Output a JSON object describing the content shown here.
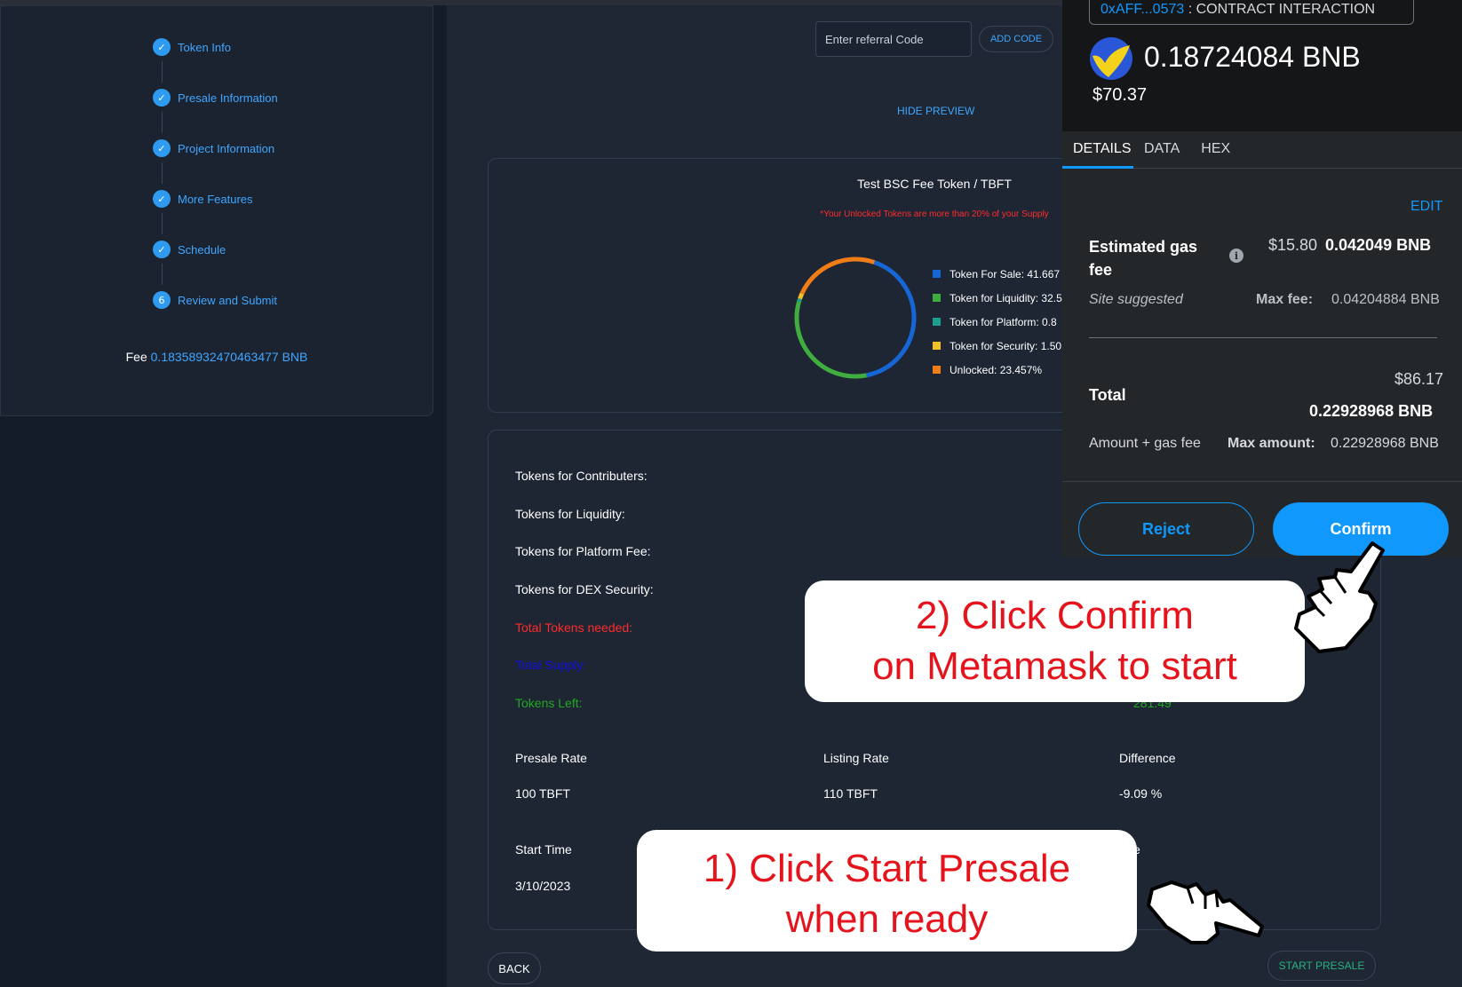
{
  "stepper": {
    "steps": [
      {
        "label": "Token Info",
        "marker": "✓"
      },
      {
        "label": "Presale Information",
        "marker": "✓"
      },
      {
        "label": "Project Information",
        "marker": "✓"
      },
      {
        "label": "More Features",
        "marker": "✓"
      },
      {
        "label": "Schedule",
        "marker": "✓"
      },
      {
        "label": "Review and Submit",
        "marker": "6"
      }
    ],
    "fee_label": "Fee",
    "fee_value": "0.18358932470463477 BNB"
  },
  "referral": {
    "placeholder": "Enter referral Code",
    "add_code_label": "ADD CODE"
  },
  "hide_preview_label": "HIDE PREVIEW",
  "token_chart": {
    "title": "Test BSC Fee Token / TBFT",
    "warning": "*Your Unlocked Tokens are more than 20% of your Supply",
    "legend": [
      {
        "label": "Token For Sale: 41.667",
        "color": "#1766d6"
      },
      {
        "label": "Token for Liquidity: 32.5",
        "color": "#3fae3f"
      },
      {
        "label": "Token for Platform: 0.8",
        "color": "#1d9e8f"
      },
      {
        "label": "Token for Security: 1.50",
        "color": "#f2c028"
      },
      {
        "label": "Unlocked: 23.457%",
        "color": "#f07d16"
      }
    ]
  },
  "chart_data": {
    "type": "pie",
    "donut": true,
    "categories": [
      "Token For Sale",
      "Token for Liquidity",
      "Token for Platform",
      "Token for Security",
      "Unlocked"
    ],
    "values": [
      41.667,
      32.5,
      0.8,
      1.5,
      23.457
    ],
    "colors": [
      "#1766d6",
      "#3fae3f",
      "#1d9e8f",
      "#f2c028",
      "#f07d16"
    ]
  },
  "summary": {
    "rows": [
      {
        "label": "Tokens for Contributers:",
        "color": "#ffffff"
      },
      {
        "label": "Tokens for Liquidity:",
        "color": "#ffffff"
      },
      {
        "label": "Tokens for Platform Fee:",
        "color": "#ffffff"
      },
      {
        "label": "Tokens for DEX Security:",
        "color": "#ffffff"
      },
      {
        "label": "Total Tokens needed:",
        "color": "#ff2b2b"
      },
      {
        "label": "Total Supply:",
        "color": "#1010e0"
      },
      {
        "label": "Tokens Left:",
        "color": "#22a822"
      }
    ],
    "tokens_left_value": "281.49",
    "presale_rate_label": "Presale Rate",
    "presale_rate_value": "100 TBFT",
    "listing_rate_label": "Listing Rate",
    "listing_rate_value": "110 TBFT",
    "difference_label": "Difference",
    "difference_value": "-9.09 %",
    "start_time_label": "Start Time",
    "start_time_value": "3/10/2023",
    "end_time_partial": "e"
  },
  "buttons": {
    "back": "BACK",
    "start_presale": "START PRESALE"
  },
  "metamask": {
    "origin_address": "0xAFF...0573",
    "origin_text": ": CONTRACT INTERACTION",
    "amount": "0.18724084 BNB",
    "amount_usd": "$70.37",
    "tabs": [
      "DETAILS",
      "DATA",
      "HEX"
    ],
    "edit_label": "EDIT",
    "gas_label": "Estimated gas fee",
    "gas_usd": "$15.80",
    "gas_bnb": "0.042049 BNB",
    "site_suggested": "Site suggested",
    "max_fee_label": "Max fee:",
    "max_fee_value": "0.04204884 BNB",
    "total_usd": "$86.17",
    "total_label": "Total",
    "total_bnb": "0.22928968 BNB",
    "amount_gas_label": "Amount + gas fee",
    "max_amount_label": "Max amount:",
    "max_amount_value": "0.22928968 BNB",
    "reject_label": "Reject",
    "confirm_label": "Confirm"
  },
  "callouts": {
    "confirm_line1": "2) Click Confirm",
    "confirm_line2": "on Metamask to start",
    "start_line1": "1) Click Start Presale",
    "start_line2": "when ready"
  }
}
